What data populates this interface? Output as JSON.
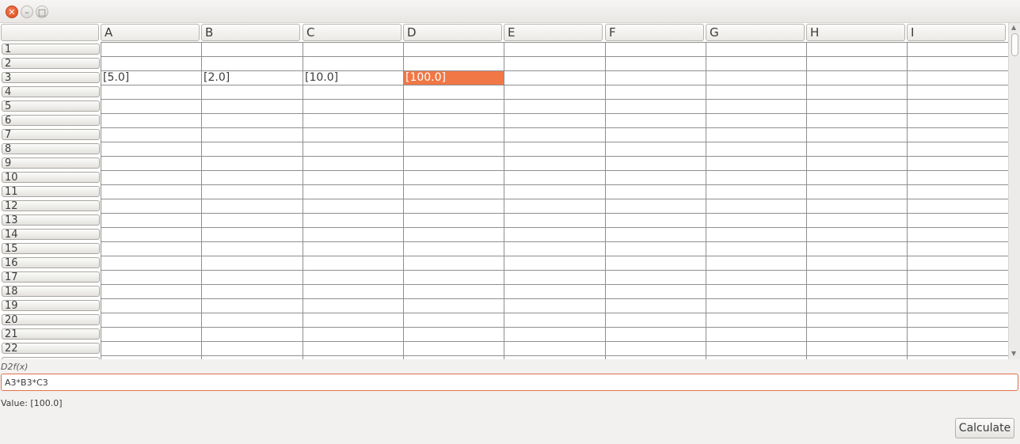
{
  "window": {
    "close_glyph": "✕",
    "minimize_glyph": "–",
    "maximize_glyph": "□"
  },
  "sheet": {
    "columns": [
      "A",
      "B",
      "C",
      "D",
      "E",
      "F",
      "G",
      "H",
      "I"
    ],
    "rows": [
      "1",
      "2",
      "3",
      "4",
      "5",
      "6",
      "7",
      "8",
      "9",
      "10",
      "11",
      "12",
      "13",
      "14",
      "15",
      "16",
      "17",
      "18",
      "19",
      "20",
      "21",
      "22"
    ],
    "cells": {
      "A3": "[5.0]",
      "B3": "[2.0]",
      "C3": "[10.0]",
      "D3": "[100.0]"
    },
    "selected_cell": "D3",
    "selected_color": "#f07746"
  },
  "formula": {
    "label": "D2f(x)",
    "value": "A3*B3*C3"
  },
  "value_label": "Value: [100.0]",
  "calculate_label": "Calculate"
}
